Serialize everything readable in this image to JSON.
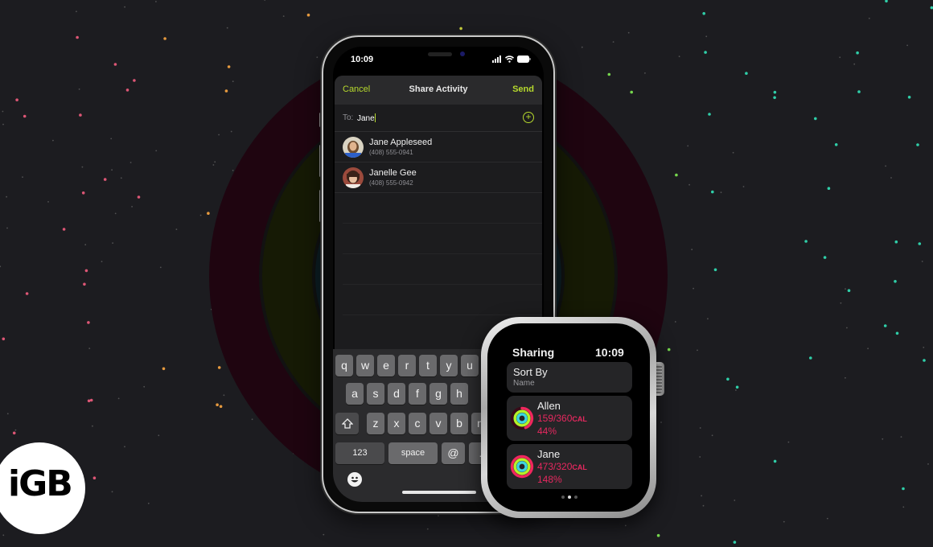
{
  "background": {
    "colors": {
      "base": "#1c1c20",
      "move_ring": "#1f0510",
      "exercise_ring": "#161a05",
      "stand_ring": "#0c1e24"
    }
  },
  "phone": {
    "status_bar": {
      "time": "10:09",
      "icons": [
        "cellular-signal-icon",
        "wifi-icon",
        "battery-icon"
      ]
    },
    "nav": {
      "cancel_label": "Cancel",
      "title": "Share Activity",
      "send_label": "Send"
    },
    "to_field": {
      "label": "To:",
      "value": "Jane",
      "add_icon": "plus-circle-icon"
    },
    "contacts": [
      {
        "name": "Jane Appleseed",
        "phone": "(408) 555-0941"
      },
      {
        "name": "Janelle Gee",
        "phone": "(408) 555-0942"
      }
    ],
    "keyboard": {
      "row1": [
        "q",
        "w",
        "e",
        "r",
        "t",
        "y",
        "u"
      ],
      "row2": [
        "a",
        "s",
        "d",
        "f",
        "g",
        "h"
      ],
      "row3": [
        "z",
        "x",
        "c",
        "v",
        "b",
        "n"
      ],
      "shift_icon": "shift-icon",
      "numbers_label": "123",
      "space_label": "space",
      "at_label": "@",
      "period_label": ".",
      "emoji_icon": "emoji-icon"
    },
    "accent_color": "#b6d92d"
  },
  "watch": {
    "title": "Sharing",
    "time": "10:09",
    "sort": {
      "title": "Sort By",
      "value": "Name"
    },
    "friends": [
      {
        "name": "Allen",
        "calories": "159/360",
        "unit": "CAL",
        "percent": "44%",
        "move_fraction": 0.44,
        "exercise_fraction": 1.0,
        "stand_fraction": 1.0
      },
      {
        "name": "Jane",
        "calories": "473/320",
        "unit": "CAL",
        "percent": "148%",
        "move_fraction": 1.0,
        "exercise_fraction": 1.0,
        "stand_fraction": 1.0
      }
    ],
    "page_indicator": {
      "total": 3,
      "current": 2
    },
    "accent_color": "#e6285f"
  },
  "logo": {
    "text": "iGB"
  }
}
